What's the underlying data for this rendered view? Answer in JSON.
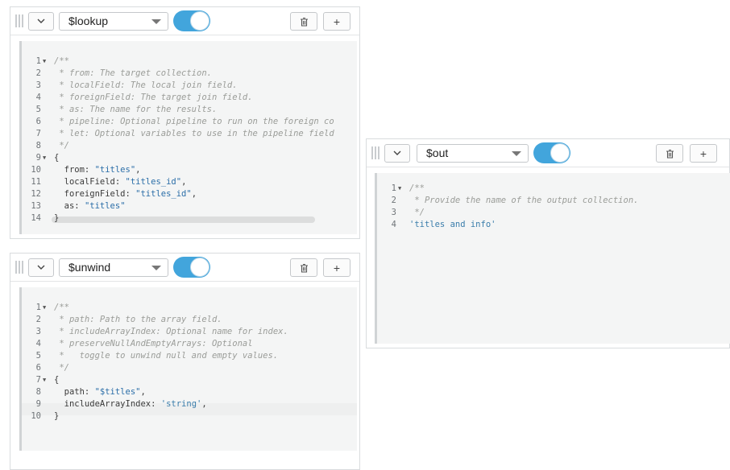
{
  "stages": {
    "lookup": {
      "operator": "$lookup",
      "lines": [
        [
          {
            "t": "/**",
            "c": "cm"
          }
        ],
        [
          {
            "t": " * from: The target collection.",
            "c": "cm"
          }
        ],
        [
          {
            "t": " * localField: The local join field.",
            "c": "cm"
          }
        ],
        [
          {
            "t": " * foreignField: The target join field.",
            "c": "cm"
          }
        ],
        [
          {
            "t": " * as: The name for the results.",
            "c": "cm"
          }
        ],
        [
          {
            "t": " * pipeline: Optional pipeline to run on the foreign co",
            "c": "cm"
          }
        ],
        [
          {
            "t": " * let: Optional variables to use in the pipeline field",
            "c": "cm"
          }
        ],
        [
          {
            "t": " */",
            "c": "cm"
          }
        ],
        [
          {
            "t": "{",
            "c": ""
          }
        ],
        [
          {
            "t": "  from: ",
            "c": ""
          },
          {
            "t": "\"titles\"",
            "c": "st"
          },
          {
            "t": ",",
            "c": ""
          }
        ],
        [
          {
            "t": "  localField: ",
            "c": ""
          },
          {
            "t": "\"titles_id\"",
            "c": "st"
          },
          {
            "t": ",",
            "c": ""
          }
        ],
        [
          {
            "t": "  foreignField: ",
            "c": ""
          },
          {
            "t": "\"titles_id\"",
            "c": "st"
          },
          {
            "t": ",",
            "c": ""
          }
        ],
        [
          {
            "t": "  as: ",
            "c": ""
          },
          {
            "t": "\"titles\"",
            "c": "st"
          }
        ],
        [
          {
            "t": "}",
            "c": ""
          }
        ]
      ],
      "folds": [
        1,
        9
      ]
    },
    "unwind": {
      "operator": "$unwind",
      "lines": [
        [
          {
            "t": "/**",
            "c": "cm"
          }
        ],
        [
          {
            "t": " * path: Path to the array field.",
            "c": "cm"
          }
        ],
        [
          {
            "t": " * includeArrayIndex: Optional name for index.",
            "c": "cm"
          }
        ],
        [
          {
            "t": " * preserveNullAndEmptyArrays: Optional",
            "c": "cm"
          }
        ],
        [
          {
            "t": " *   toggle to unwind null and empty values.",
            "c": "cm"
          }
        ],
        [
          {
            "t": " */",
            "c": "cm"
          }
        ],
        [
          {
            "t": "{",
            "c": ""
          }
        ],
        [
          {
            "t": "  path: ",
            "c": ""
          },
          {
            "t": "\"$titles\"",
            "c": "st"
          },
          {
            "t": ",",
            "c": ""
          }
        ],
        [
          {
            "t": "  includeArrayIndex: ",
            "c": ""
          },
          {
            "t": "'string'",
            "c": "ss"
          },
          {
            "t": ",",
            "c": ""
          }
        ],
        [
          {
            "t": "}",
            "c": ""
          }
        ]
      ],
      "folds": [
        1,
        7
      ]
    },
    "out": {
      "operator": "$out",
      "lines": [
        [
          {
            "t": "/**",
            "c": "cm"
          }
        ],
        [
          {
            "t": " * Provide the name of the output collection.",
            "c": "cm"
          }
        ],
        [
          {
            "t": " */",
            "c": "cm"
          }
        ],
        [
          {
            "t": "'titles and info'",
            "c": "ss"
          }
        ]
      ],
      "folds": [
        1
      ]
    }
  },
  "icons": {
    "collapse": "chevron-down-icon",
    "delete": "trash-icon",
    "add": "plus-icon",
    "drag": "drag-handle-icon"
  },
  "colors": {
    "toggle_on": "#42a5dc",
    "comment": "#9a9c98",
    "string": "#2b6ea8"
  },
  "add_label": "+",
  "collapse_glyph": "⌄"
}
